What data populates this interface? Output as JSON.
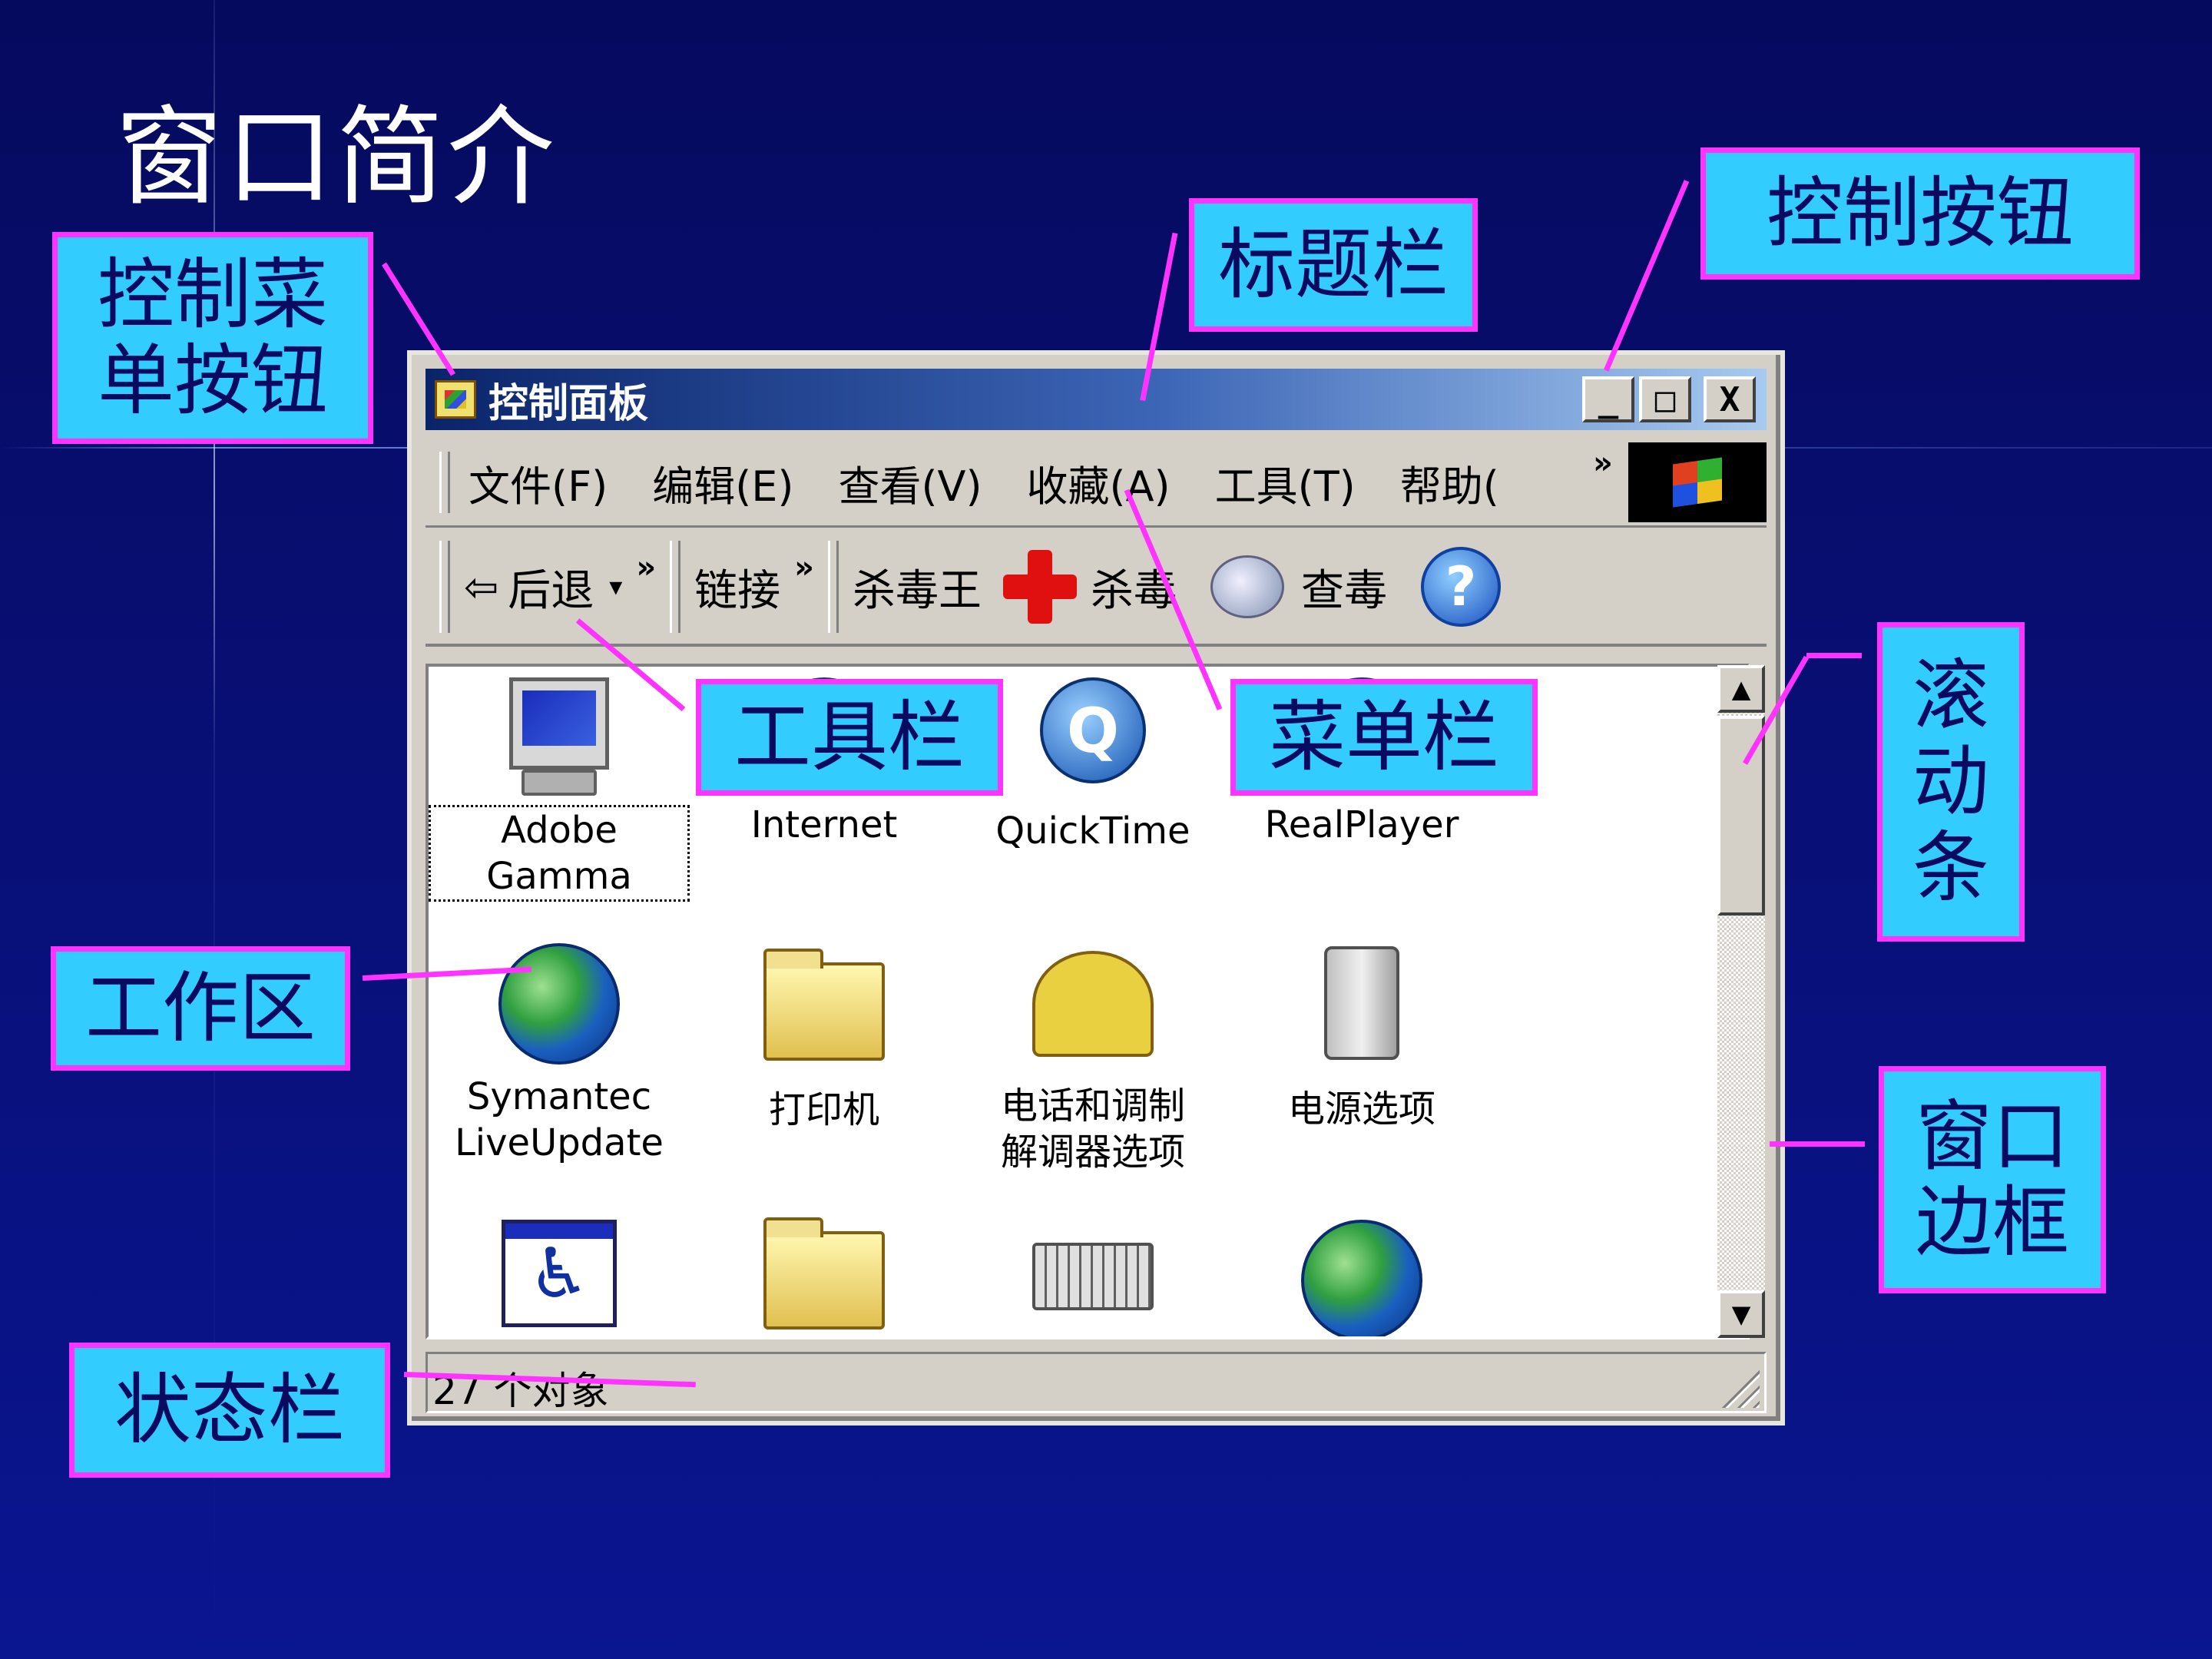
{
  "slide": {
    "title": "窗口简介"
  },
  "labels": {
    "control_menu_button": "控制菜单按钮",
    "title_bar": "标题栏",
    "control_buttons": "控制按钮",
    "toolbar": "工具栏",
    "menu_bar": "菜单栏",
    "scroll_bar": "滚动条",
    "work_area": "工作区",
    "window_border": "窗口边框",
    "status_bar": "状态栏"
  },
  "window": {
    "title": "控制面板",
    "control_glyphs": {
      "minimize": "_",
      "maximize": "□",
      "close": "X"
    },
    "menu": [
      "文件(F)",
      "编辑(E)",
      "查看(V)",
      "收藏(A)",
      "工具(T)",
      "帮助(",
      "»"
    ],
    "toolbar": {
      "back": "后退",
      "back_arrow": "⇦",
      "dropdown": "▾",
      "chevron": "»",
      "links": "链接",
      "antivirus": "杀毒王",
      "kill": "杀毒",
      "check": "查毒",
      "help_glyph": "?"
    },
    "items": [
      {
        "label": "Adobe Gamma",
        "icon": "monitor-icon",
        "selected": true
      },
      {
        "label": "Internet",
        "icon": "globe-icon"
      },
      {
        "label": "QuickTime",
        "icon": "quicktime-icon",
        "glyph": "Q"
      },
      {
        "label": "RealPlayer",
        "icon": "realplayer-icon"
      },
      {
        "label": "Symantec\nLiveUpdate",
        "icon": "globe-icon"
      },
      {
        "label": "打印机",
        "icon": "printer-folder-icon"
      },
      {
        "label": "电话和调制\n解调器选项",
        "icon": "telephone-icon"
      },
      {
        "label": "电源选项",
        "icon": "power-plug-icon"
      },
      {
        "label": "",
        "icon": "accessibility-icon",
        "glyph": "♿"
      },
      {
        "label": "",
        "icon": "admin-tools-folder-icon"
      },
      {
        "label": "",
        "icon": "keyboard-icon"
      },
      {
        "label": "",
        "icon": "globe-icon"
      }
    ],
    "scroll_glyphs": {
      "up": "▲",
      "down": "▼"
    },
    "status": "27 个对象"
  },
  "colors": {
    "label_fill": "#33ccff",
    "label_border": "#ff33ff",
    "background": "#0a1590",
    "titlebar": "#0a246a"
  }
}
